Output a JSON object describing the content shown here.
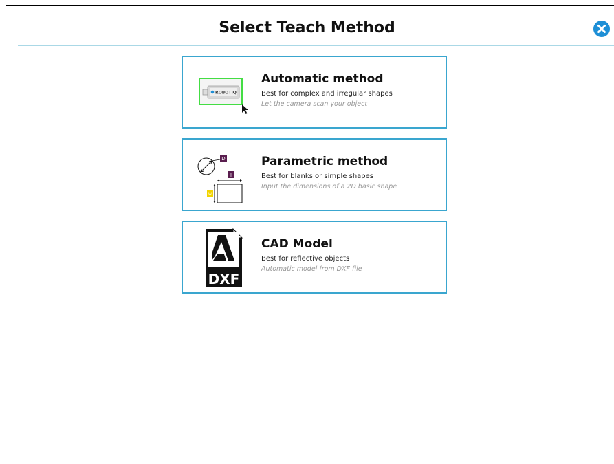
{
  "dialog": {
    "title": "Select Teach Method",
    "close_icon": "close-icon",
    "accent": "#1e8fd6"
  },
  "methods": [
    {
      "title": "Automatic method",
      "description": "Best for complex and irregular shapes",
      "hint": "Let the camera scan your object",
      "icon": "camera-scan-icon",
      "logo_text": "ROBOTIQ"
    },
    {
      "title": "Parametric method",
      "description": "Best for blanks or simple shapes",
      "hint": "Input the dimensions of a 2D basic shape",
      "icon": "parametric-shape-icon",
      "dimension_labels": [
        "D",
        "l",
        "w"
      ]
    },
    {
      "title": "CAD Model",
      "description": "Best for reflective objects",
      "hint": "Automatic model from DXF file",
      "icon": "dxf-file-icon",
      "file_label": "DXF"
    }
  ],
  "colors": {
    "card_border": "#3aa6cf",
    "scan_box": "#44dd44",
    "dimension_d": "#5a1e4f",
    "dimension_w": "#f2d400"
  }
}
